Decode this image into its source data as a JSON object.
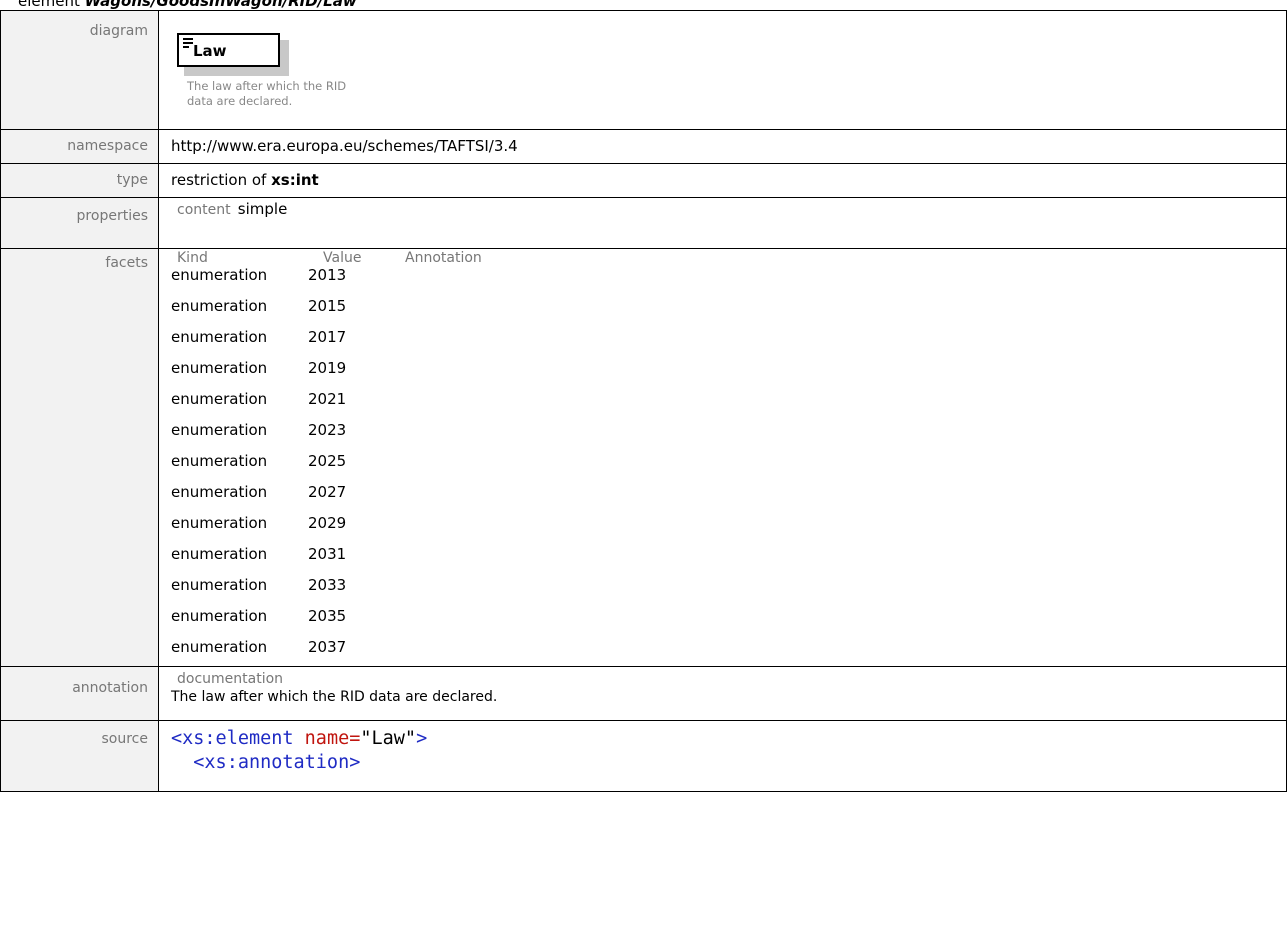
{
  "header": {
    "prefix": "element",
    "path": "Wagons/GoodsInWagon/RID/Law"
  },
  "diagram": {
    "label": "diagram",
    "element_name": "Law",
    "documentation_lines": [
      "The law after which the RID",
      "data are declared."
    ]
  },
  "namespace": {
    "label": "namespace",
    "value": "http://www.era.europa.eu/schemes/TAFTSI/3.4"
  },
  "type": {
    "label": "type",
    "prefix": "restriction of",
    "base": "xs:int"
  },
  "properties": {
    "label": "properties",
    "key": "content",
    "value": "simple"
  },
  "facets": {
    "label": "facets",
    "headers": [
      "Kind",
      "Value",
      "Annotation"
    ],
    "rows": [
      {
        "kind": "enumeration",
        "value": "2013"
      },
      {
        "kind": "enumeration",
        "value": "2015"
      },
      {
        "kind": "enumeration",
        "value": "2017"
      },
      {
        "kind": "enumeration",
        "value": "2019"
      },
      {
        "kind": "enumeration",
        "value": "2021"
      },
      {
        "kind": "enumeration",
        "value": "2023"
      },
      {
        "kind": "enumeration",
        "value": "2025"
      },
      {
        "kind": "enumeration",
        "value": "2027"
      },
      {
        "kind": "enumeration",
        "value": "2029"
      },
      {
        "kind": "enumeration",
        "value": "2031"
      },
      {
        "kind": "enumeration",
        "value": "2033"
      },
      {
        "kind": "enumeration",
        "value": "2035"
      },
      {
        "kind": "enumeration",
        "value": "2037"
      }
    ]
  },
  "annotation": {
    "label": "annotation",
    "key": "documentation",
    "text": "The law after which the RID data are declared."
  },
  "source": {
    "label": "source",
    "line1": {
      "open": "<xs:element",
      "attr": " name=",
      "value": "\"Law\"",
      "close": ">"
    },
    "line2": "  <xs:annotation>"
  }
}
